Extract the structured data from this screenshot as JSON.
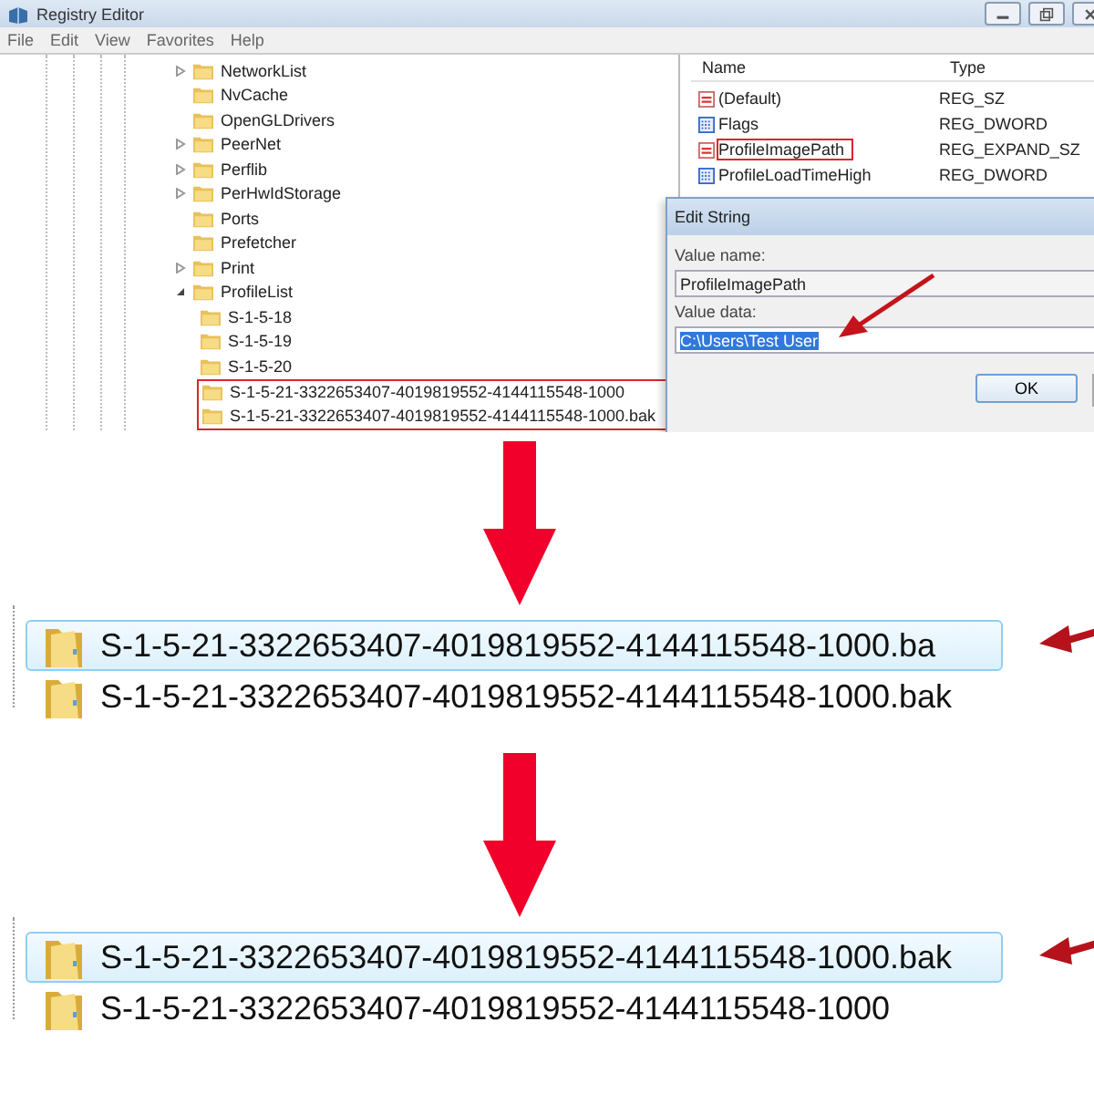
{
  "window": {
    "title": "Registry Editor",
    "menu": [
      "File",
      "Edit",
      "View",
      "Favorites",
      "Help"
    ]
  },
  "tree": [
    {
      "label": "NetworkList",
      "expandable": true,
      "expanded": false
    },
    {
      "label": "NvCache",
      "expandable": false
    },
    {
      "label": "OpenGLDrivers",
      "expandable": false
    },
    {
      "label": "PeerNet",
      "expandable": true,
      "expanded": false
    },
    {
      "label": "Perflib",
      "expandable": true,
      "expanded": false
    },
    {
      "label": "PerHwIdStorage",
      "expandable": true,
      "expanded": false
    },
    {
      "label": "Ports",
      "expandable": false
    },
    {
      "label": "Prefetcher",
      "expandable": false
    },
    {
      "label": "Print",
      "expandable": true,
      "expanded": false
    },
    {
      "label": "ProfileList",
      "expandable": true,
      "expanded": true,
      "children": [
        {
          "label": "S-1-5-18",
          "highlighted": false
        },
        {
          "label": "S-1-5-19",
          "highlighted": false
        },
        {
          "label": "S-1-5-20",
          "highlighted": false
        },
        {
          "label": "S-1-5-21-3322653407-4019819552-4144115548-1000",
          "highlighted": true
        },
        {
          "label": "S-1-5-21-3322653407-4019819552-4144115548-1000.bak",
          "highlighted": true
        }
      ]
    }
  ],
  "values": {
    "columns": [
      "Name",
      "Type"
    ],
    "rows": [
      {
        "name": "(Default)",
        "type": "REG_SZ",
        "kind": "string",
        "highlighted": false
      },
      {
        "name": "Flags",
        "type": "REG_DWORD",
        "kind": "binary",
        "highlighted": false
      },
      {
        "name": "ProfileImagePath",
        "type": "REG_EXPAND_SZ",
        "kind": "string",
        "highlighted": true
      },
      {
        "name": "ProfileLoadTimeHigh",
        "type": "REG_DWORD",
        "kind": "binary",
        "highlighted": false
      }
    ]
  },
  "dialog": {
    "title": "Edit String",
    "name_label": "Value name:",
    "name_value": "ProfileImagePath",
    "data_label": "Value data:",
    "data_value": "C:\\Users\\Test User",
    "data_selected": true,
    "buttons": [
      "OK"
    ]
  },
  "steps": [
    {
      "rows": [
        {
          "label": "S-1-5-21-3322653407-4019819552-4144115548-1000.ba",
          "selected": true
        },
        {
          "label": "S-1-5-21-3322653407-4019819552-4144115548-1000.bak",
          "selected": false
        }
      ]
    },
    {
      "rows": [
        {
          "label": "S-1-5-21-3322653407-4019819552-4144115548-1000.bak",
          "selected": true
        },
        {
          "label": "S-1-5-21-3322653407-4019819552-4144115548-1000",
          "selected": false
        }
      ]
    }
  ]
}
